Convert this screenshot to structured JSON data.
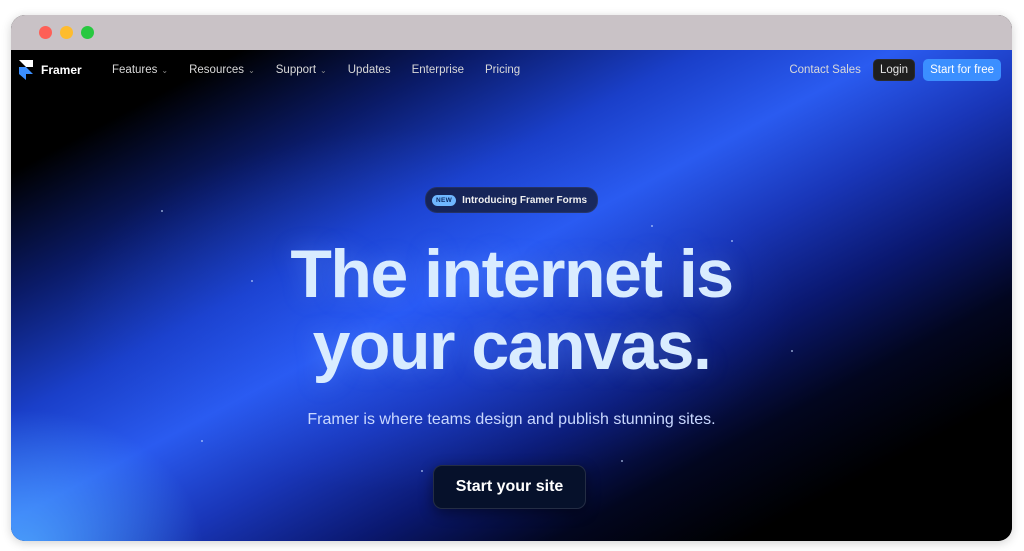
{
  "nav": {
    "brand": "Framer",
    "links": [
      {
        "label": "Features",
        "dropdown": true
      },
      {
        "label": "Resources",
        "dropdown": true
      },
      {
        "label": "Support",
        "dropdown": true
      },
      {
        "label": "Updates",
        "dropdown": false
      },
      {
        "label": "Enterprise",
        "dropdown": false
      },
      {
        "label": "Pricing",
        "dropdown": false
      }
    ],
    "contact_sales": "Contact Sales",
    "login": "Login",
    "start_free": "Start for free",
    "chevron": "⌄"
  },
  "hero": {
    "badge_pill": "NEW",
    "badge_text": "Introducing Framer Forms",
    "headline_line1": "The internet is",
    "headline_line2": "your canvas.",
    "subtitle": "Framer is where teams design and publish stunning sites.",
    "cta": "Start your site"
  },
  "colors": {
    "accent": "#3b8fff",
    "headline": "#d9ecff",
    "background": "#000000"
  }
}
